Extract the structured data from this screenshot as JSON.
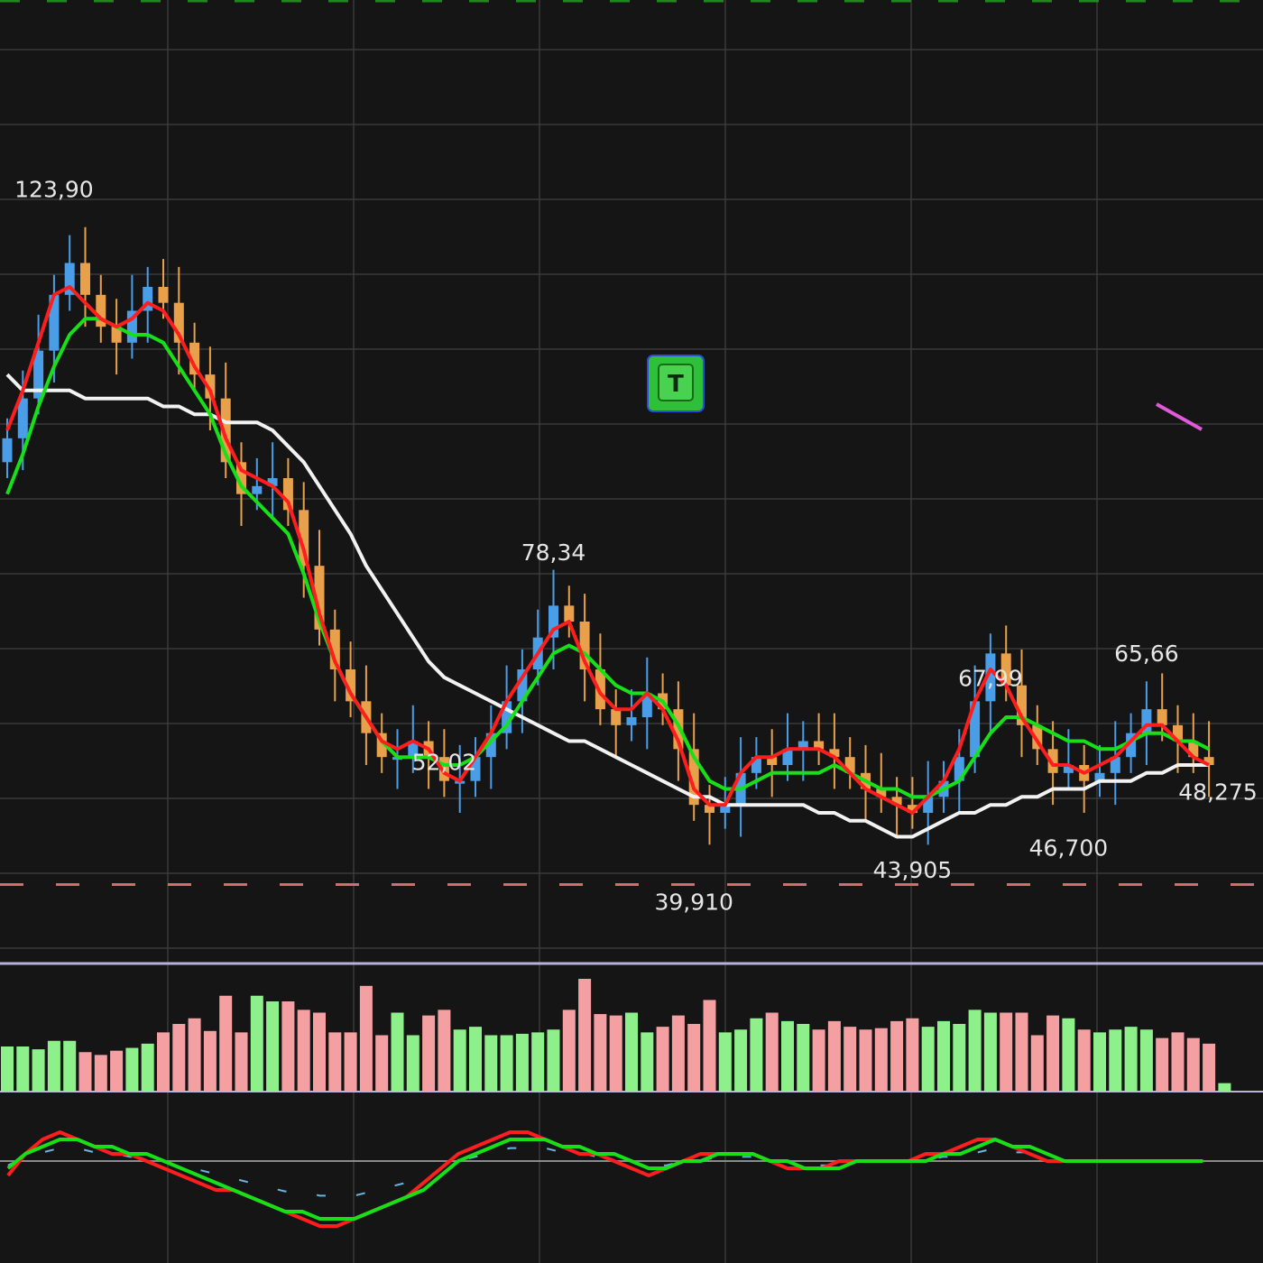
{
  "colors": {
    "background": "#151515",
    "grid": "#3a3a3a",
    "candle_up": "#4a9ee8",
    "candle_down": "#e8a14a",
    "ema_fast": "#ff1e1e",
    "ema_slow": "#18e018",
    "ma_long": "#f2f2f2",
    "volume_up": "#8ef08a",
    "volume_down": "#f4a0a2",
    "support_line": "#d86a6a",
    "top_dashed": "#1e8a1e",
    "separator": "#b8b4d8",
    "badge_fill": "#2fbf3a",
    "drawing_line": "#e05ad8",
    "sig_yellow": "#e8d060",
    "sig_blue": "#6ab4e0"
  },
  "badge": {
    "label": "T"
  },
  "chart_data": {
    "type": "candlestick",
    "title": "",
    "xlabel": "",
    "ylabel": "",
    "ylim": [
      30,
      150
    ],
    "grid": true,
    "legend": "none",
    "price_labels": [
      {
        "text": "123,90",
        "value": 123.9,
        "bar": 3
      },
      {
        "text": "78,34",
        "value": 78.34,
        "bar": 35
      },
      {
        "text": "52,02",
        "value": 52.02,
        "bar": 28
      },
      {
        "text": "39,910",
        "value": 39.91,
        "bar": 44
      },
      {
        "text": "43,905",
        "value": 43.905,
        "bar": 58
      },
      {
        "text": "67,99",
        "value": 67.99,
        "bar": 63
      },
      {
        "text": "46,700",
        "value": 46.7,
        "bar": 68
      },
      {
        "text": "65,66",
        "value": 65.66,
        "bar": 73
      },
      {
        "text": "48,275",
        "value": 48.275,
        "bar": 78
      }
    ],
    "support_level": 39.0,
    "close": [
      95,
      100,
      106,
      113,
      117,
      113,
      109,
      107,
      111,
      114,
      112,
      107,
      103,
      100,
      92,
      88,
      89,
      90,
      86,
      79,
      71,
      66,
      62,
      58,
      55,
      55,
      57,
      55,
      52,
      52,
      55,
      58,
      62,
      66,
      70,
      74,
      72,
      66,
      61,
      59,
      60,
      63,
      61,
      56,
      49,
      48,
      49,
      53,
      55,
      54,
      56,
      57,
      56,
      55,
      53,
      51,
      50,
      49,
      48,
      50,
      52,
      55,
      62,
      68,
      64,
      59,
      56,
      53,
      54,
      52,
      53,
      55,
      58,
      61,
      59,
      57,
      55,
      54
    ],
    "ema_fast": [
      96,
      101,
      107,
      113,
      114,
      112,
      110,
      109,
      110,
      112,
      111,
      108,
      104,
      101,
      95,
      91,
      90,
      89,
      87,
      81,
      73,
      67,
      63,
      60,
      57,
      56,
      57,
      56,
      53,
      52,
      55,
      58,
      62,
      65,
      68,
      71,
      72,
      67,
      63,
      61,
      61,
      63,
      61,
      57,
      51,
      49,
      49,
      53,
      55,
      55,
      56,
      56,
      56,
      55,
      53,
      51,
      50,
      49,
      48,
      50,
      52,
      56,
      62,
      66,
      64,
      60,
      57,
      54,
      54,
      53,
      54,
      55,
      57,
      59,
      59,
      57,
      55,
      54
    ],
    "ema_slow": [
      88,
      93,
      99,
      104,
      108,
      110,
      110,
      109,
      108,
      108,
      107,
      104,
      101,
      98,
      93,
      89,
      87,
      85,
      83,
      78,
      72,
      67,
      63,
      60,
      57,
      55,
      55,
      55,
      54,
      54,
      55,
      57,
      59,
      62,
      65,
      68,
      69,
      68,
      66,
      64,
      63,
      63,
      62,
      59,
      55,
      52,
      51,
      51,
      52,
      53,
      53,
      53,
      53,
      54,
      53,
      52,
      51,
      51,
      50,
      50,
      51,
      52,
      55,
      58,
      60,
      60,
      59,
      58,
      57,
      57,
      56,
      56,
      57,
      58,
      58,
      57,
      57,
      56
    ],
    "ma_long": [
      103,
      101,
      101,
      101,
      101,
      100,
      100,
      100,
      100,
      100,
      99,
      99,
      98,
      98,
      97,
      97,
      97,
      96,
      94,
      92,
      89,
      86,
      83,
      79,
      76,
      73,
      70,
      67,
      65,
      64,
      63,
      62,
      61,
      60,
      59,
      58,
      57,
      57,
      56,
      55,
      54,
      53,
      52,
      51,
      50,
      50,
      49,
      49,
      49,
      49,
      49,
      49,
      48,
      48,
      47,
      47,
      46,
      45,
      45,
      46,
      47,
      48,
      48,
      49,
      49,
      50,
      50,
      51,
      51,
      51,
      52,
      52,
      52,
      53,
      53,
      54,
      54,
      54
    ],
    "volume": [
      32,
      32,
      30,
      36,
      36,
      28,
      26,
      29,
      31,
      34,
      42,
      48,
      52,
      43,
      68,
      42,
      68,
      64,
      64,
      58,
      56,
      42,
      42,
      75,
      40,
      56,
      40,
      54,
      58,
      44,
      46,
      40,
      40,
      41,
      42,
      44,
      58,
      80,
      55,
      54,
      56,
      42,
      46,
      54,
      48,
      65,
      42,
      44,
      52,
      56,
      50,
      48,
      44,
      50,
      46,
      44,
      45,
      50,
      52,
      46,
      50,
      48,
      58,
      56,
      56,
      56,
      40,
      54,
      52,
      44,
      42,
      44,
      46,
      44,
      38,
      42,
      38,
      34,
      6
    ],
    "macd": [
      -2,
      1,
      3,
      4,
      3,
      2,
      1,
      1,
      0,
      -1,
      -2,
      -3,
      -4,
      -4,
      -5,
      -6,
      -7,
      -8,
      -9,
      -9,
      -8,
      -7,
      -6,
      -5,
      -3,
      -1,
      1,
      2,
      3,
      4,
      4,
      3,
      2,
      1,
      1,
      0,
      -1,
      -2,
      -1,
      0,
      1,
      1,
      1,
      1,
      0,
      -1,
      -1,
      -1,
      0,
      0,
      0,
      0,
      0,
      1,
      1,
      2,
      3,
      3,
      2,
      1,
      0,
      0,
      0,
      0,
      0,
      0,
      0,
      0,
      0,
      0
    ],
    "signal": [
      -1,
      1,
      2,
      3,
      3,
      2,
      2,
      1,
      1,
      0,
      -1,
      -2,
      -3,
      -4,
      -5,
      -6,
      -7,
      -7,
      -8,
      -8,
      -8,
      -7,
      -6,
      -5,
      -4,
      -2,
      0,
      1,
      2,
      3,
      3,
      3,
      2,
      2,
      1,
      1,
      0,
      -1,
      -1,
      0,
      0,
      1,
      1,
      1,
      0,
      0,
      -1,
      -1,
      -1,
      0,
      0,
      0,
      0,
      0,
      1,
      1,
      2,
      3,
      2,
      2,
      1,
      0,
      0,
      0,
      0,
      0,
      0,
      0,
      0,
      0
    ]
  }
}
